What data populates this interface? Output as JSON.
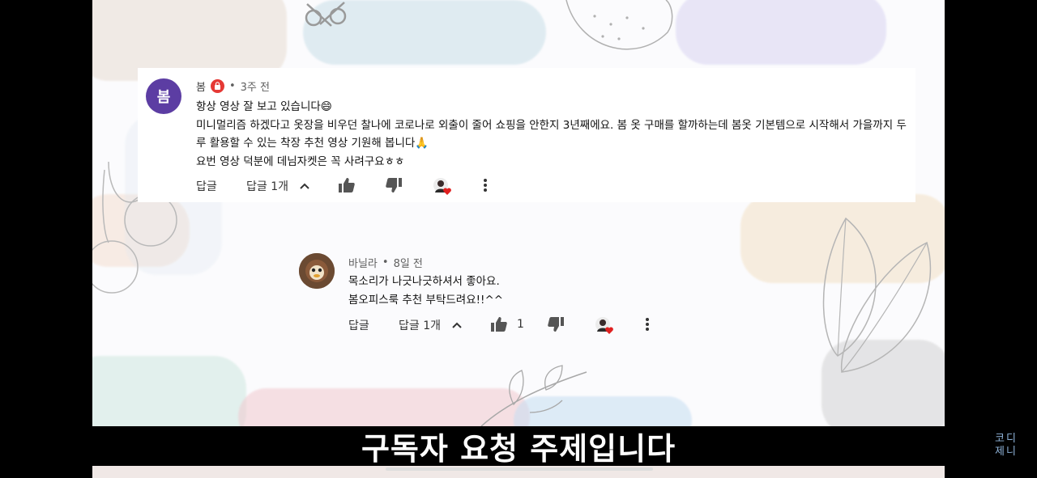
{
  "comment": {
    "avatar_letter": "봄",
    "author": "봄",
    "time": "3주 전",
    "lines": [
      "항상 영상 잘 보고 있습니다😄",
      "미니멀리즘 하겠다고 옷장을 비우던 찰나에 코로나로 외출이 줄어 쇼핑을 안한지 3년째에요. 봄 옷 구매를 할까하는데 봄옷 기본템으로 시작해서 가을까지 두",
      "루 활용할 수 있는 착장 추천 영상 기원해 봅니다🙏",
      "요번 영상 덕분에 데님자켓은 꼭 사려구요ㅎㅎ"
    ],
    "reply_label": "답글",
    "replies_toggle": "답글 1개",
    "like_count": ""
  },
  "reply": {
    "author": "바닐라",
    "time": "8일 전",
    "lines": [
      "목소리가 나긋나긋하셔서 좋아요.",
      "봄오피스룩 추천 부탁드려요!!^^"
    ],
    "reply_label": "답글",
    "replies_toggle": "답글 1개",
    "like_count": "1"
  },
  "subtitle": "구독자 요청 주제입니다",
  "watermark": [
    "코디",
    "제니"
  ],
  "icons": {
    "like": "thumb-up-icon",
    "dislike": "thumb-down-icon",
    "heart": "creator-heart-icon",
    "more": "more-vert-icon",
    "chevron": "chevron-up-icon",
    "badge": "channel-badge-icon"
  },
  "colors": {
    "avatar": "#5c3da3",
    "badge": "#e53935",
    "heart": "#e02020"
  }
}
